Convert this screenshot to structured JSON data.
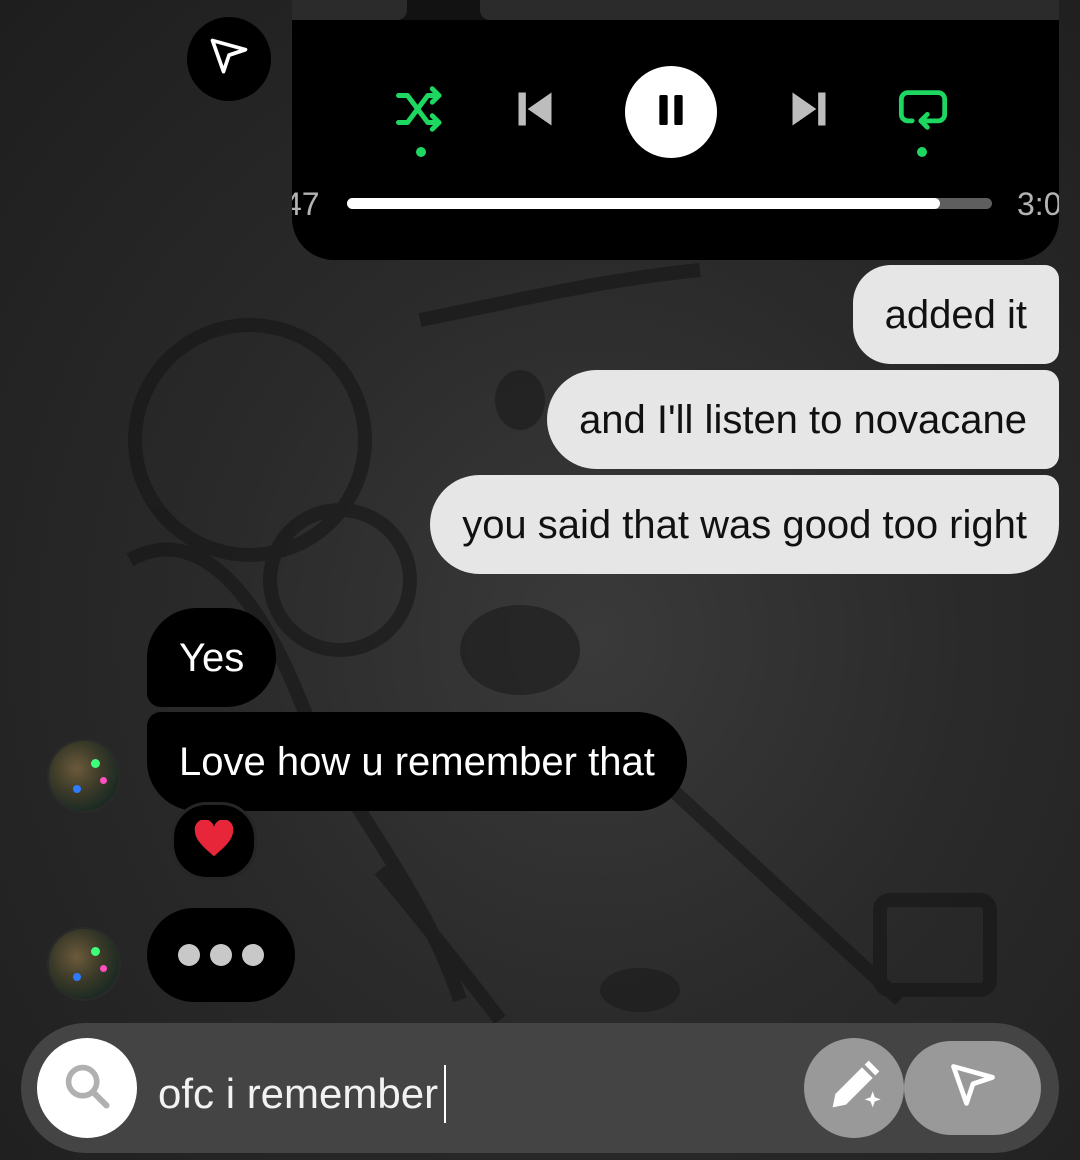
{
  "media_player": {
    "elapsed": "47",
    "duration": "3:0",
    "progress_percent": 92,
    "shuffle_active": true,
    "repeat_active": true,
    "state": "playing",
    "accent_color": "#1ed760"
  },
  "messages": [
    {
      "from": "me",
      "text": "added it"
    },
    {
      "from": "me",
      "text": "and I'll listen to novacane"
    },
    {
      "from": "me",
      "text": "you said that was good too right"
    },
    {
      "from": "them",
      "text": "Yes"
    },
    {
      "from": "them",
      "text": "Love how u remember that"
    }
  ],
  "reaction": {
    "emoji": "❤️"
  },
  "typing_indicator": true,
  "composer": {
    "draft": "ofc i remember"
  },
  "icons": [
    "paper-plane-icon",
    "shuffle-icon",
    "previous-icon",
    "pause-icon",
    "next-icon",
    "repeat-icon",
    "search-icon",
    "pencil-sparkle-icon",
    "send-icon"
  ],
  "colors": {
    "outgoing_bubble": "#e6e6e6",
    "incoming_bubble": "#000000",
    "composer": "#444444"
  }
}
